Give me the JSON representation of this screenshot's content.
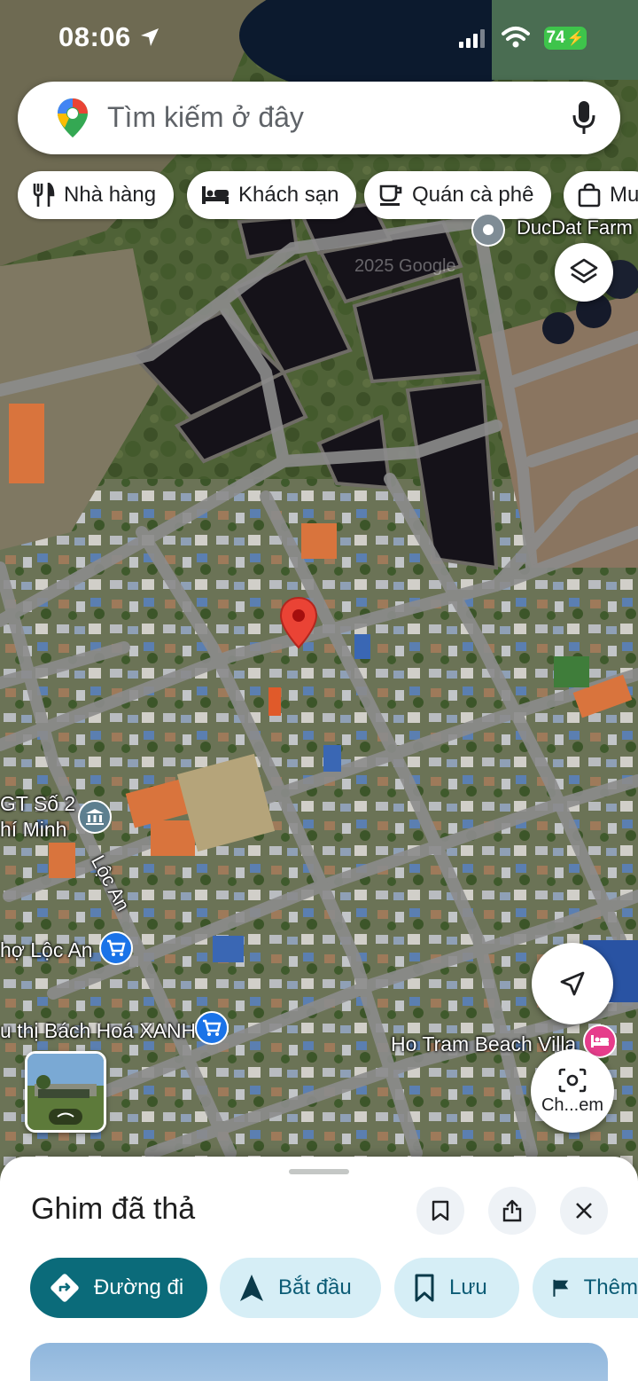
{
  "status": {
    "time": "08:06",
    "battery": "74",
    "icons": [
      "location-arrow-icon",
      "signal-icon",
      "wifi-icon",
      "battery-icon"
    ]
  },
  "search": {
    "placeholder": "Tìm kiếm ở đây",
    "icons": [
      "google-maps-logo",
      "mic-icon"
    ]
  },
  "chips": [
    {
      "label": "Nhà hàng",
      "icon": "restaurant-icon"
    },
    {
      "label": "Khách sạn",
      "icon": "hotel-icon"
    },
    {
      "label": "Quán cà phê",
      "icon": "coffee-icon"
    },
    {
      "label": "Mu",
      "icon": "shopping-icon"
    }
  ],
  "map": {
    "pin_color": "#ea4335",
    "labels": {
      "ducdat": "DucDat Farm",
      "school_line1": "GT Số 2",
      "school_line2": "hí Minh",
      "road": "Lộc An",
      "market": "hợ Lộc An",
      "bachhoa": "u thị Bách Hoá XANH",
      "villa": "Ho Tram Beach Villa",
      "watermark": "2025 Google"
    },
    "camera_label": "Ch...em"
  },
  "sheet": {
    "title": "Ghim đã thả",
    "actions": [
      {
        "label": "Đường đi",
        "icon": "directions-icon"
      },
      {
        "label": "Bắt đầu",
        "icon": "navigation-arrow-icon"
      },
      {
        "label": "Lưu",
        "icon": "bookmark-icon"
      },
      {
        "label": "Thêm",
        "icon": "flag-icon"
      }
    ]
  },
  "colors": {
    "accent_teal": "#0b6b7a",
    "chip_bg_light": "#d6eef6",
    "battery_green": "#3ec44b"
  }
}
